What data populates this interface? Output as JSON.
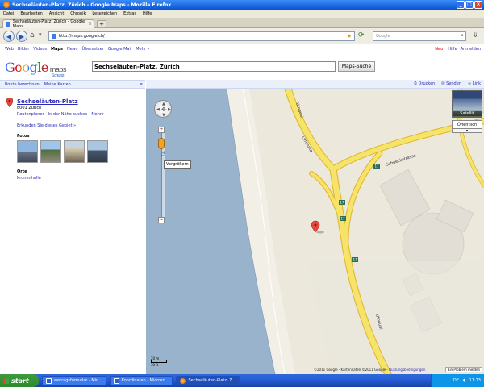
{
  "window": {
    "title": "Sechseläuten-Platz, Zürich - Google Maps - Mozilla Firefox",
    "minimize": "_",
    "maximize": "□",
    "close": "×"
  },
  "menu": [
    "Datei",
    "Bearbeiten",
    "Ansicht",
    "Chronik",
    "Lesezeichen",
    "Extras",
    "Hilfe"
  ],
  "tab": {
    "title": "Sechseläuten-Platz, Zürich - Google Maps",
    "close": "×",
    "new": "+"
  },
  "nav": {
    "back": "◀",
    "forward": "▶",
    "url": "http://maps.google.ch/",
    "search_placeholder": "Google"
  },
  "gbar": {
    "links": [
      "Web",
      "Bilder",
      "Videos",
      "Maps",
      "News",
      "Übersetzer",
      "Google Mail",
      "Mehr ▾"
    ],
    "active": "Maps",
    "right": [
      "Neu!",
      "Hilfe",
      "Anmelden"
    ]
  },
  "header": {
    "logo": "Google",
    "product": "maps",
    "region": "Schweiz",
    "query": "Sechseläuten-Platz, Zürich",
    "search_button": "Maps-Suche"
  },
  "left": {
    "links": [
      "Route berechnen",
      "Meine Karten"
    ],
    "collapse": "«",
    "place": {
      "name": "Sechseläuten-Platz",
      "address": "8001 Zürich",
      "actions": [
        "Routenplaner",
        "In der Nähe suchen",
        "Mehr▾"
      ],
      "explore": "Erkunden Sie dieses Gebiet »"
    },
    "photos_label": "Fotos",
    "orte_label": "Orte",
    "orte_item": "Kronenhalle"
  },
  "map": {
    "tools": [
      "Drucken",
      "Senden",
      "Link"
    ],
    "tooltip": "Vergrößern",
    "zoom_in": "+",
    "zoom_out": "−",
    "zoom_level": 0.12,
    "maptype_satellite": "Satellit",
    "maptype_more": "Öffentlich",
    "scale_m": "20 m",
    "scale_ft": "50 ft",
    "copyright": "©2011 Google - Kartendaten ©2011 Google -",
    "terms": "Nutzungsbedingungen",
    "report": "Ein Problem melden",
    "streets": [
      "Utoquai",
      "Limmatq.",
      "Schoeckstrasse",
      "Utoquai"
    ],
    "route_shields": [
      "17",
      "17",
      "17",
      "17"
    ],
    "colors": {
      "water": "#99b3cc",
      "land": "#ece8dc",
      "road": "#f6e46a",
      "road_edge": "#e0b429",
      "building": "#e2ded5"
    }
  },
  "taskbar": {
    "start": "start",
    "tasks": [
      "wetragsformular - Mic...",
      "Koordinaten - Microso...",
      "Sechseläuten-Platz, Z..."
    ],
    "lang": "DE",
    "time": "17:13"
  }
}
